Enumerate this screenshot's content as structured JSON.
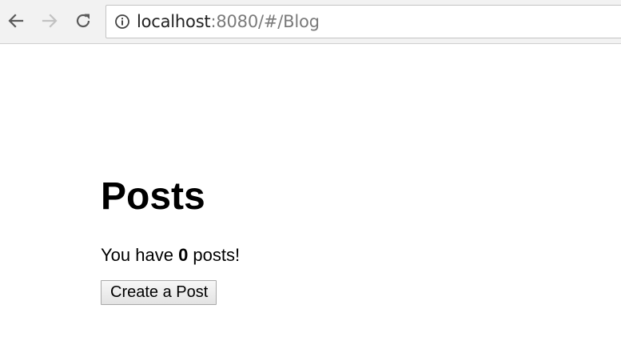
{
  "browser": {
    "url_host": "localhost",
    "url_rest": ":8080/#/Blog",
    "icons": {
      "back": "back-arrow-icon",
      "forward": "forward-arrow-icon",
      "reload": "reload-icon",
      "info": "info-icon"
    }
  },
  "page": {
    "title": "Posts",
    "count_prefix": "You have ",
    "count_value": "0",
    "count_suffix": " posts!",
    "create_button_label": "Create a Post"
  }
}
